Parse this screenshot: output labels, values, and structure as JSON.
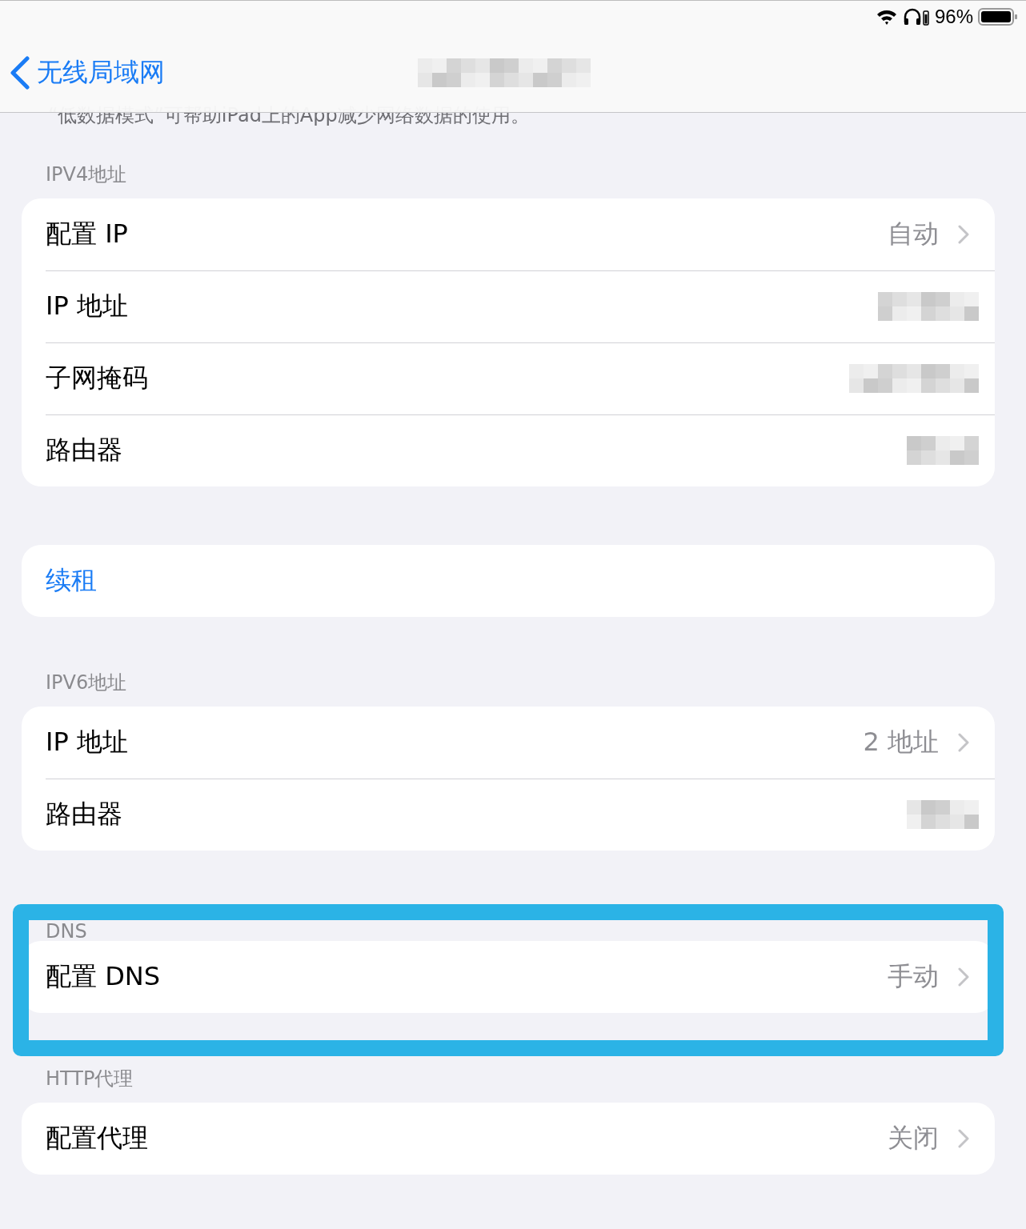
{
  "status_bar": {
    "battery": "96%"
  },
  "nav": {
    "back": "无线局域网",
    "title": {
      "kind": "redacted"
    }
  },
  "footnote": "“低数据模式”可帮助iPad上的App减少网络数据的使用。",
  "sections": [
    {
      "header": "IPV4地址",
      "highlighted": false,
      "rows": [
        {
          "kind": "disclosure",
          "label": "配置 IP",
          "value": "自动"
        },
        {
          "kind": "redacted",
          "label": "IP 地址"
        },
        {
          "kind": "redacted",
          "label": "子网掩码"
        },
        {
          "kind": "redacted",
          "label": "路由器"
        }
      ]
    },
    {
      "highlighted": false,
      "rows": [
        {
          "kind": "action",
          "label": "续租"
        }
      ]
    },
    {
      "header": "IPV6地址",
      "highlighted": false,
      "rows": [
        {
          "kind": "disclosure",
          "label": "IP 地址",
          "value": "2 地址"
        },
        {
          "kind": "redacted",
          "label": "路由器"
        }
      ]
    },
    {
      "header": "DNS",
      "highlighted": true,
      "rows": [
        {
          "kind": "disclosure",
          "label": "配置 DNS",
          "value": "手动"
        }
      ]
    },
    {
      "header": "HTTP代理",
      "highlighted": false,
      "rows": [
        {
          "kind": "disclosure",
          "label": "配置代理",
          "value": "关闭"
        }
      ]
    }
  ]
}
